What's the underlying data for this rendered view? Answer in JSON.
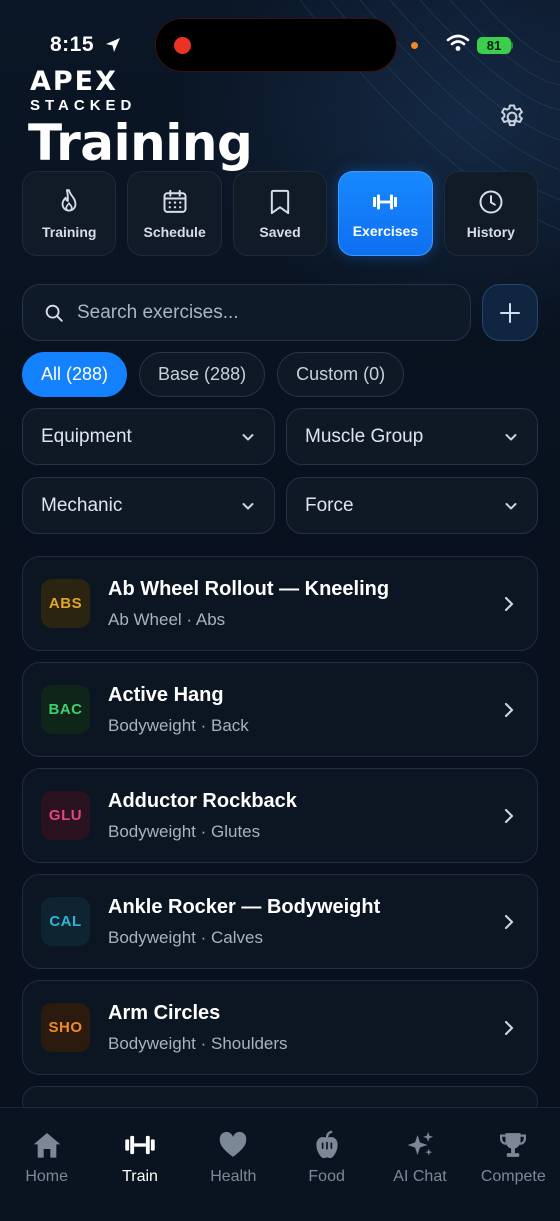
{
  "status_bar": {
    "time": "8:15",
    "battery": "81"
  },
  "header": {
    "brand": "APEX",
    "brand_sub": "STACKED",
    "title": "Training"
  },
  "tabs": [
    {
      "label": "Training",
      "icon": "flame-icon"
    },
    {
      "label": "Schedule",
      "icon": "calendar-icon"
    },
    {
      "label": "Saved",
      "icon": "bookmark-icon"
    },
    {
      "label": "Exercises",
      "icon": "dumbbell-icon",
      "active": true
    },
    {
      "label": "History",
      "icon": "clock-icon"
    }
  ],
  "search": {
    "placeholder": "Search exercises..."
  },
  "chips": [
    {
      "label": "All (288)",
      "active": true
    },
    {
      "label": "Base (288)"
    },
    {
      "label": "Custom (0)"
    }
  ],
  "filters": [
    {
      "label": "Equipment"
    },
    {
      "label": "Muscle Group"
    },
    {
      "label": "Mechanic"
    },
    {
      "label": "Force"
    }
  ],
  "exercises": [
    {
      "badge": "ABS",
      "title": "Ab Wheel Rollout — Kneeling",
      "subtitle": "Ab Wheel · Abs",
      "badge_color": "#e0a52a",
      "badge_bg": "#2a2410"
    },
    {
      "badge": "BAC",
      "title": "Active Hang",
      "subtitle": "Bodyweight · Back",
      "badge_color": "#3ecf6a",
      "badge_bg": "#0f2519"
    },
    {
      "badge": "GLU",
      "title": "Adductor Rockback",
      "subtitle": "Bodyweight · Glutes",
      "badge_color": "#e0487f",
      "badge_bg": "#2a1220"
    },
    {
      "badge": "CAL",
      "title": "Ankle Rocker — Bodyweight",
      "subtitle": "Bodyweight · Calves",
      "badge_color": "#2fb3d6",
      "badge_bg": "#0e2430"
    },
    {
      "badge": "SHO",
      "title": "Arm Circles",
      "subtitle": "Bodyweight · Shoulders",
      "badge_color": "#ef8a2c",
      "badge_bg": "#2b1b0e"
    }
  ],
  "bottom_nav": [
    {
      "label": "Home",
      "icon": "home-icon"
    },
    {
      "label": "Train",
      "icon": "dumbbell-icon",
      "active": true
    },
    {
      "label": "Health",
      "icon": "heart-icon"
    },
    {
      "label": "Food",
      "icon": "apple-icon"
    },
    {
      "label": "AI Chat",
      "icon": "sparkles-icon"
    },
    {
      "label": "Compete",
      "icon": "trophy-icon"
    }
  ],
  "colors": {
    "accent": "#1482ff",
    "background": "#08111d"
  }
}
